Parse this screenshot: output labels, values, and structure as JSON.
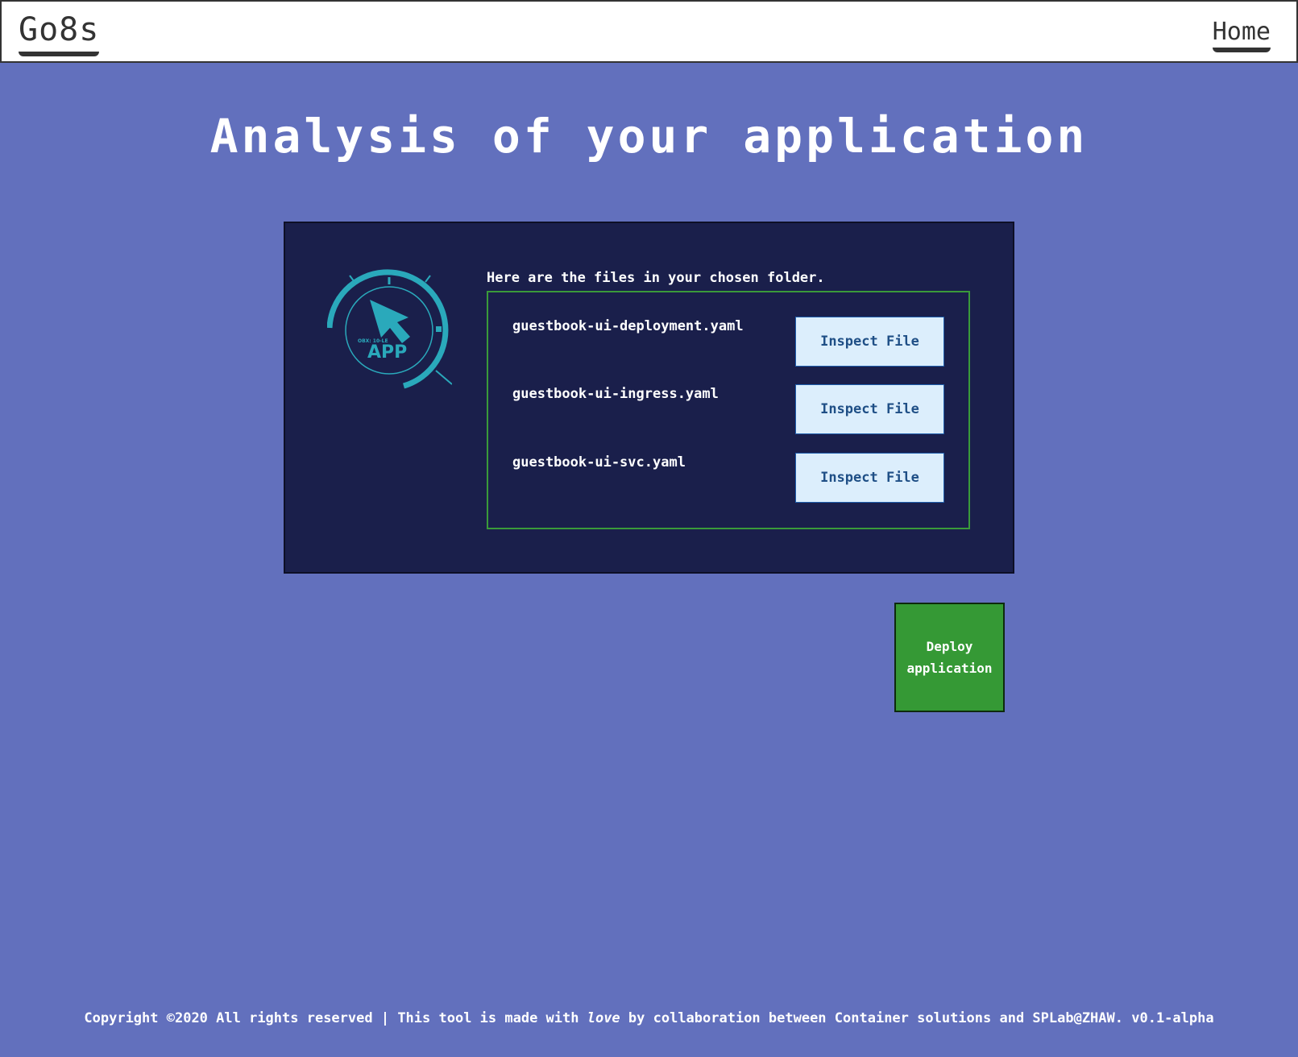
{
  "nav": {
    "brand": "Go8s",
    "home_label": "Home"
  },
  "page": {
    "title": "Analysis of your application"
  },
  "panel": {
    "logo_big": "APP",
    "logo_small": "OBX: 10-LE",
    "intro": "Here are the files in your chosen folder.",
    "files": [
      {
        "name": "guestbook-ui-deployment.yaml",
        "button": "Inspect File"
      },
      {
        "name": "guestbook-ui-ingress.yaml",
        "button": "Inspect File"
      },
      {
        "name": "guestbook-ui-svc.yaml",
        "button": "Inspect File"
      }
    ]
  },
  "deploy": {
    "line1": "Deploy",
    "line2": "application"
  },
  "footer": {
    "part1": "Copyright ©2020 All rights reserved | This tool is made with ",
    "love": "love",
    "part2": " by collaboration between Container solutions and SPLab@ZHAW. v0.1-alpha"
  },
  "colors": {
    "background": "#6270bd",
    "panel": "#1a1f4b",
    "accent_green": "#359935",
    "logo_teal": "#2aa9bb"
  }
}
